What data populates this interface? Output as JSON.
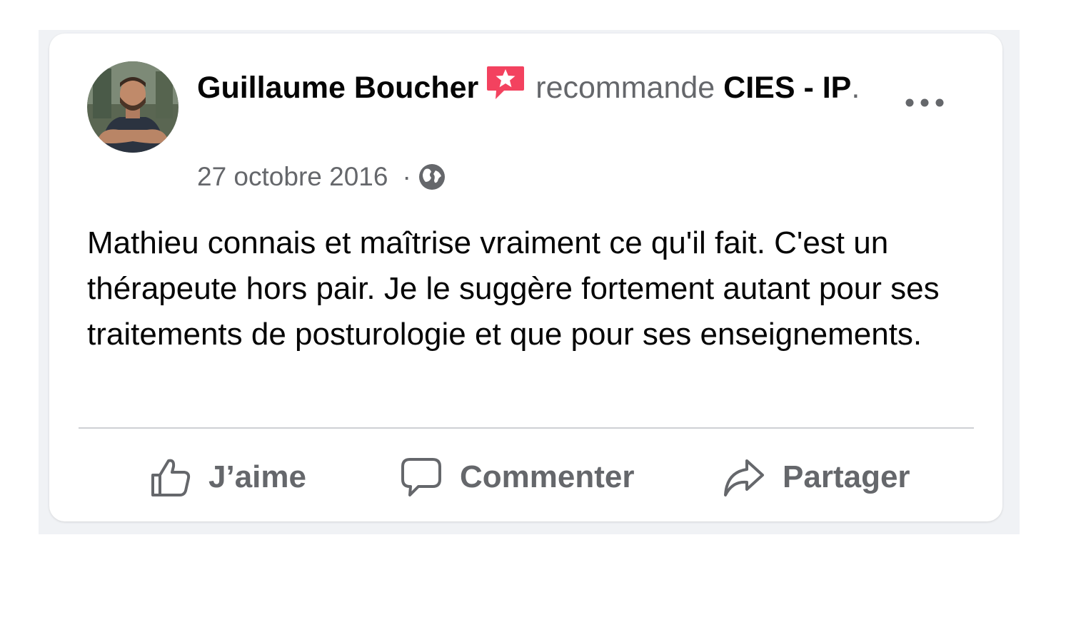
{
  "post": {
    "author": "Guillaume Boucher",
    "action": "recommande",
    "page": "CIES - IP",
    "period": ".",
    "date": "27 octobre 2016",
    "separator": "·",
    "privacy_icon": "globe-icon",
    "badge_icon": "recommendation-star-icon",
    "more_icon": "more-options-icon",
    "text": "Mathieu connais et maîtrise vraiment ce qu'il fait. C'est un thérapeute hors pair. Je le suggère fortement autant pour ses traitements de posturologie et que pour ses enseignements."
  },
  "actions": {
    "like": "J’aime",
    "comment": "Commenter",
    "share": "Partager"
  },
  "colors": {
    "primary_text": "#050505",
    "secondary_text": "#65676b",
    "badge": "#f3425f",
    "divider": "#ced0d4",
    "backdrop": "#f0f2f5"
  }
}
